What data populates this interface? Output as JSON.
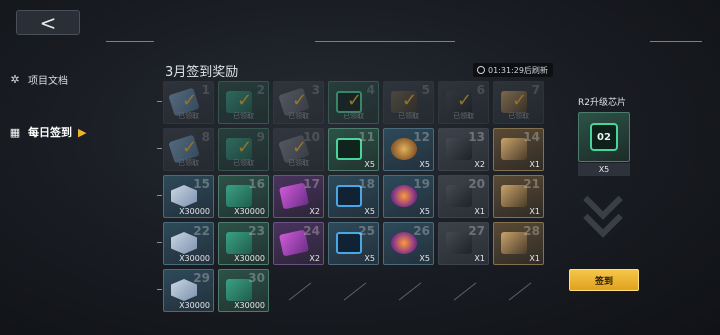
{
  "nav": {
    "back_label": "<"
  },
  "sidebar": {
    "items": [
      {
        "label": "项目文档",
        "icon": "gear-icon"
      },
      {
        "label": "每日签到",
        "icon": "calendar-icon"
      }
    ]
  },
  "panel": {
    "title": "3月签到奖励",
    "timer": "01:31:29后刷新"
  },
  "rewards": [
    {
      "day": 1,
      "qty": "",
      "status": "已领取",
      "claimed": true
    },
    {
      "day": 2,
      "qty": "",
      "status": "已领取",
      "claimed": true
    },
    {
      "day": 3,
      "qty": "",
      "status": "已领取",
      "claimed": true
    },
    {
      "day": 4,
      "qty": "",
      "status": "已领取",
      "claimed": true
    },
    {
      "day": 5,
      "qty": "",
      "status": "已领取",
      "claimed": true
    },
    {
      "day": 6,
      "qty": "",
      "status": "已领取",
      "claimed": true
    },
    {
      "day": 7,
      "qty": "",
      "status": "已领取",
      "claimed": true
    },
    {
      "day": 8,
      "qty": "",
      "status": "已领取",
      "claimed": true
    },
    {
      "day": 9,
      "qty": "",
      "status": "已领取",
      "claimed": true
    },
    {
      "day": 10,
      "qty": "",
      "status": "已领取",
      "claimed": true
    },
    {
      "day": 11,
      "qty": "X5",
      "status": "",
      "claimed": false
    },
    {
      "day": 12,
      "qty": "X5",
      "status": "",
      "claimed": false
    },
    {
      "day": 13,
      "qty": "X2",
      "status": "",
      "claimed": false
    },
    {
      "day": 14,
      "qty": "X1",
      "status": "",
      "claimed": false
    },
    {
      "day": 15,
      "qty": "X30000",
      "status": "",
      "claimed": false
    },
    {
      "day": 16,
      "qty": "X30000",
      "status": "",
      "claimed": false
    },
    {
      "day": 17,
      "qty": "X2",
      "status": "",
      "claimed": false
    },
    {
      "day": 18,
      "qty": "X5",
      "status": "",
      "claimed": false
    },
    {
      "day": 19,
      "qty": "X5",
      "status": "",
      "claimed": false
    },
    {
      "day": 20,
      "qty": "X1",
      "status": "",
      "claimed": false
    },
    {
      "day": 21,
      "qty": "X1",
      "status": "",
      "claimed": false
    },
    {
      "day": 22,
      "qty": "X30000",
      "status": "",
      "claimed": false
    },
    {
      "day": 23,
      "qty": "X30000",
      "status": "",
      "claimed": false
    },
    {
      "day": 24,
      "qty": "X2",
      "status": "",
      "claimed": false
    },
    {
      "day": 25,
      "qty": "X5",
      "status": "",
      "claimed": false
    },
    {
      "day": 26,
      "qty": "X5",
      "status": "",
      "claimed": false
    },
    {
      "day": 27,
      "qty": "X1",
      "status": "",
      "claimed": false
    },
    {
      "day": 28,
      "qty": "X1",
      "status": "",
      "claimed": false
    },
    {
      "day": 29,
      "qty": "X30000",
      "status": "",
      "claimed": false
    },
    {
      "day": 30,
      "qty": "X30000",
      "status": "",
      "claimed": false
    }
  ],
  "preview": {
    "title": "R2升级芯片",
    "chip_label": "02",
    "qty": "X5"
  },
  "sign_button": "签到",
  "colors": {
    "accent": "#f3b52a",
    "button": "#f0b429",
    "background": "#14171d"
  }
}
